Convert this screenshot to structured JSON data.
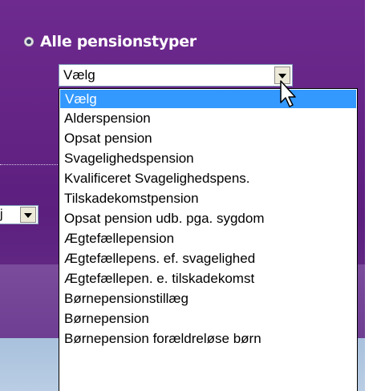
{
  "filter": {
    "radio_label": "Alle pensionstyper",
    "select_value": "Vælg",
    "options": [
      "Vælg",
      "Alderspension",
      "Opsat pension",
      "Svagelighedspension",
      "Kvalificeret Svagelighedspens.",
      "Tilskadekomstpension",
      "Opsat pension udb. pga. sygdom",
      "Ægtefællepension",
      "Ægtefællepens. ef. svagelighed",
      "Ægtefællepen. e. tilskadekomst",
      "Børnepensionstillæg",
      "Børnepension",
      "Børnepension forældreløse børn"
    ],
    "highlighted_option": "Vælg"
  },
  "side_select": {
    "visible_text": "j"
  },
  "colors": {
    "background_purple": "#5c1f7e",
    "highlight": "#3399ff"
  },
  "icons": [
    "radio-selected-icon",
    "dropdown-arrow-icon",
    "mouse-pointer-icon"
  ]
}
